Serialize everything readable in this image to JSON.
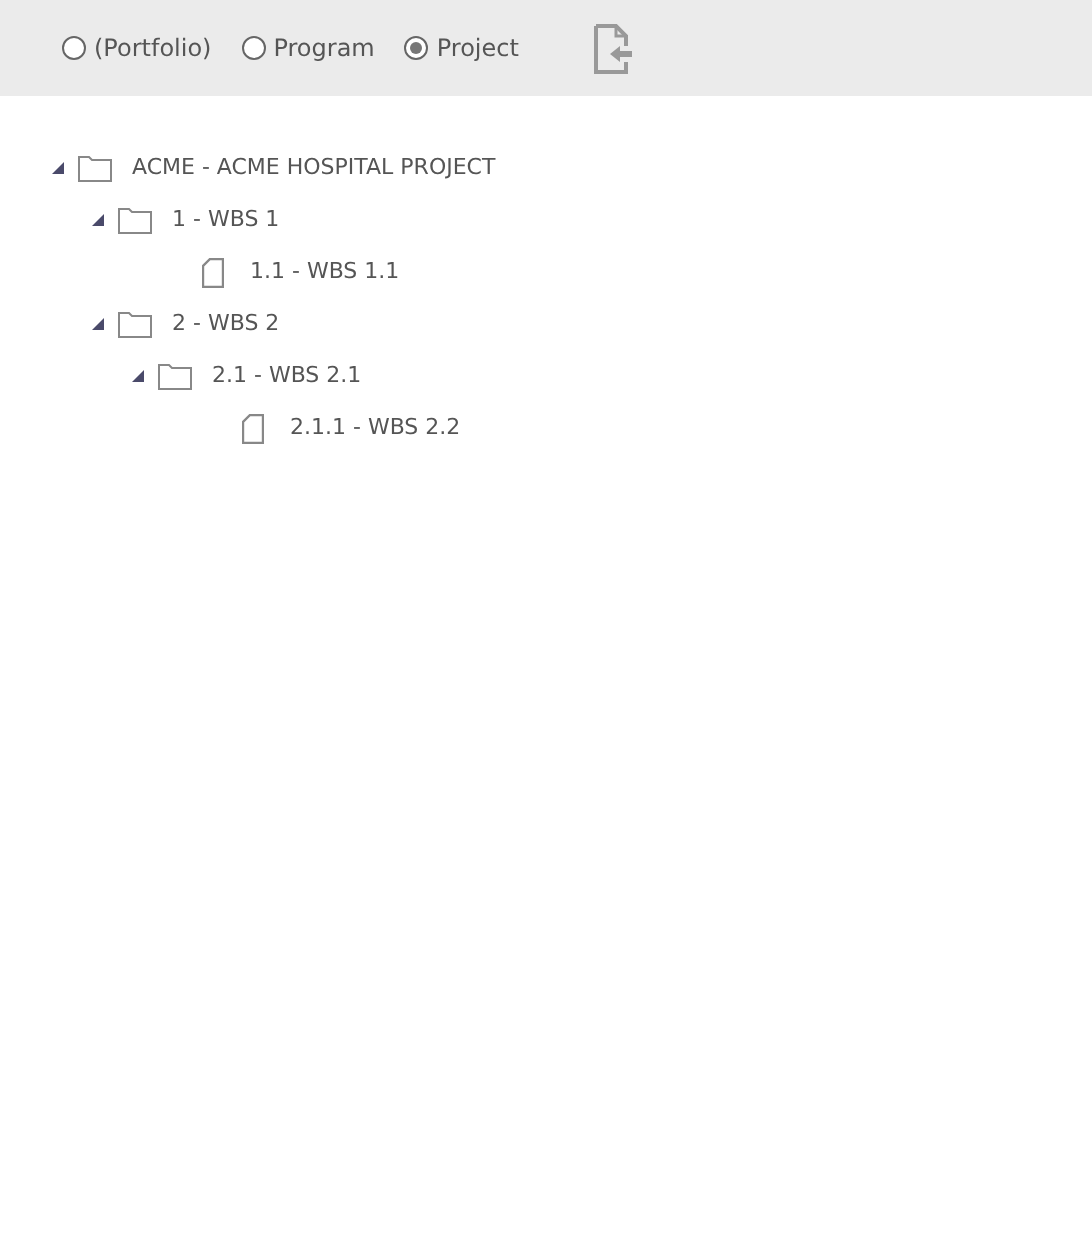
{
  "scope_options": [
    {
      "label": "(Portfolio)",
      "selected": false
    },
    {
      "label": "Program",
      "selected": false
    },
    {
      "label": "Project",
      "selected": true
    }
  ],
  "tree": [
    {
      "kind": "folder",
      "label": "ACME - ACME HOSPITAL PROJECT",
      "expanded": true,
      "children": [
        {
          "kind": "folder",
          "label": "1 - WBS 1",
          "expanded": true,
          "children": [
            {
              "kind": "file",
              "label": "1.1 - WBS 1.1"
            }
          ]
        },
        {
          "kind": "folder",
          "label": "2 - WBS 2",
          "expanded": true,
          "children": [
            {
              "kind": "folder",
              "label": "2.1 - WBS 2.1",
              "expanded": true,
              "children": [
                {
                  "kind": "file",
                  "label": "2.1.1 - WBS 2.2"
                }
              ]
            }
          ]
        }
      ]
    }
  ]
}
